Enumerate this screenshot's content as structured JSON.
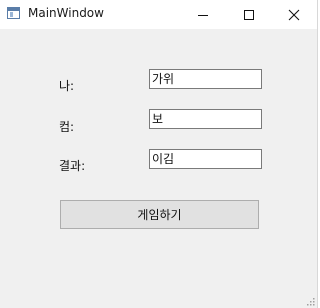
{
  "window": {
    "title": "MainWindow"
  },
  "form": {
    "me_label": "나:",
    "me_value": "가위",
    "computer_label": "컴:",
    "computer_value": "보",
    "result_label": "결과:",
    "result_value": "이김"
  },
  "actions": {
    "play_label": "게임하기"
  },
  "icons": {
    "app": "app-window-icon",
    "minimize": "minimize-icon",
    "maximize": "maximize-icon",
    "close": "close-icon",
    "resize": "resize-grip-icon"
  }
}
